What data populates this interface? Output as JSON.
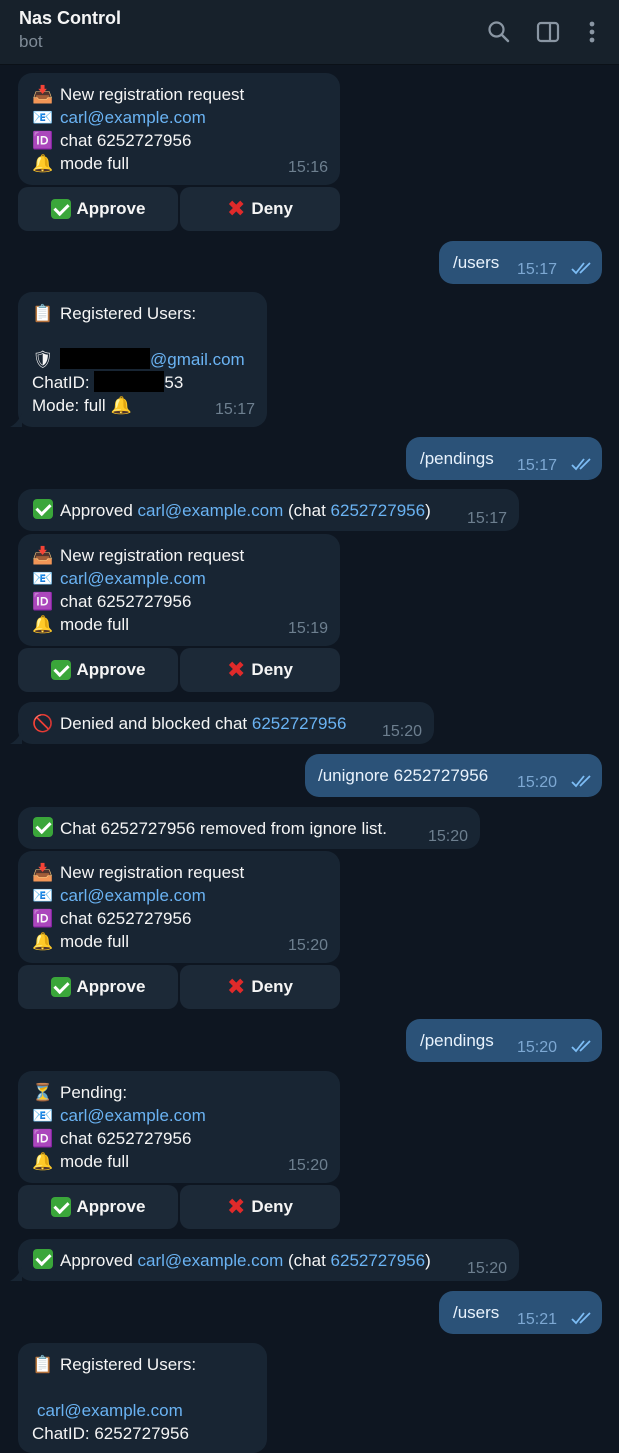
{
  "header": {
    "title": "Nas Control",
    "subtitle": "bot"
  },
  "icons": {
    "search": "search-icon",
    "sidebar": "sidebar-toggle-icon",
    "more": "more-vertical-icon",
    "tray": "inbox-tray-emoji",
    "envelope": "envelope-emoji",
    "id": "id-emoji",
    "bell": "bell-emoji",
    "clipboard": "clipboard-emoji",
    "check": "check-mark-emoji",
    "cross": "cross-mark-emoji",
    "prohibited": "prohibited-emoji",
    "hourglass": "hourglass-emoji",
    "shield": "shield-emoji"
  },
  "colors": {
    "background": "#0e1621",
    "incoming": "#182533",
    "outgoing": "#2b5278",
    "link": "#6ab3f3",
    "header": "#17212b"
  },
  "messages": {
    "m1": {
      "title": "New registration request",
      "email": "carl@example.com",
      "chat": "chat 6252727956",
      "mode": "mode full",
      "time": "15:16",
      "approve": "Approve",
      "deny": "Deny"
    },
    "m2": {
      "text": "/users",
      "time": "15:17"
    },
    "m3": {
      "title": "Registered Users:",
      "email_suffix": "@gmail.com",
      "chatid_label": "ChatID:",
      "chatid_suffix": "53",
      "mode": "Mode: full",
      "time": "15:17"
    },
    "m4": {
      "text": "/pendings",
      "time": "15:17"
    },
    "m5": {
      "prefix": "Approved",
      "email": "carl@example.com",
      "chat_open": "(chat",
      "chat_id": "6252727956",
      "close": ")",
      "time": "15:17"
    },
    "m6": {
      "title": "New registration request",
      "email": "carl@example.com",
      "chat": "chat 6252727956",
      "mode": "mode full",
      "time": "15:19",
      "approve": "Approve",
      "deny": "Deny"
    },
    "m7": {
      "prefix": "Denied and blocked chat",
      "chat_id": "6252727956",
      "time": "15:20"
    },
    "m8": {
      "text": "/unignore 6252727956",
      "time": "15:20"
    },
    "m9": {
      "text": "Chat 6252727956 removed from ignore list.",
      "time": "15:20"
    },
    "m10": {
      "title": "New registration request",
      "email": "carl@example.com",
      "chat": "chat 6252727956",
      "mode": "mode full",
      "time": "15:20",
      "approve": "Approve",
      "deny": "Deny"
    },
    "m11": {
      "text": "/pendings",
      "time": "15:20"
    },
    "m12": {
      "title": "Pending:",
      "email": "carl@example.com",
      "chat": "chat 6252727956",
      "mode": "mode full",
      "time": "15:20",
      "approve": "Approve",
      "deny": "Deny"
    },
    "m13": {
      "prefix": "Approved",
      "email": "carl@example.com",
      "chat_open": "(chat",
      "chat_id": "6252727956",
      "close": ")",
      "time": "15:20"
    },
    "m14": {
      "text": "/users",
      "time": "15:21"
    },
    "m15": {
      "title": "Registered Users:",
      "email": "carl@example.com",
      "chatid_partial": "ChatID: 6252727956"
    }
  }
}
